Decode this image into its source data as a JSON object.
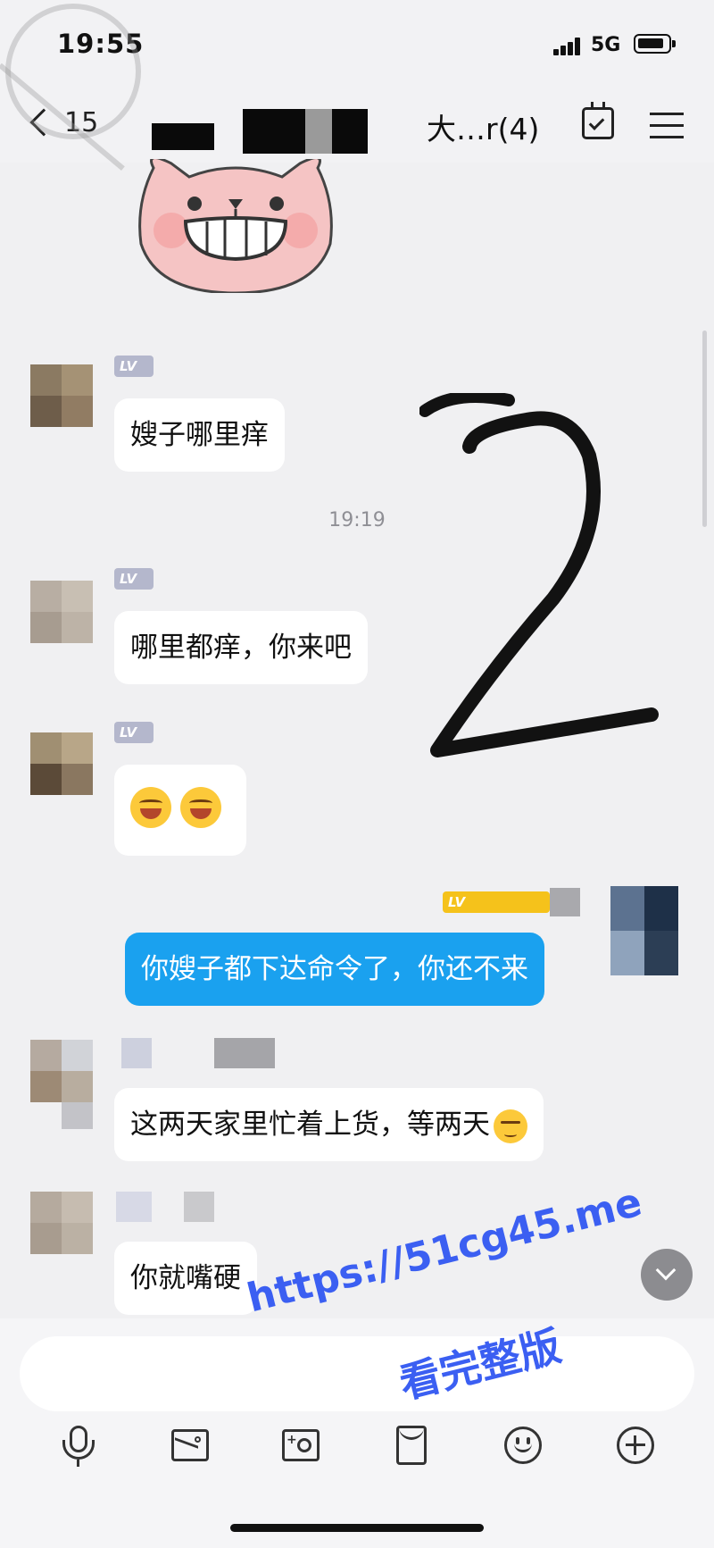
{
  "status_bar": {
    "time": "19:55",
    "network": "5G"
  },
  "header": {
    "back_count": "15",
    "title_visible_tail": "大…r(4)"
  },
  "messages": {
    "m1": {
      "text": "嫂子哪里痒"
    },
    "timestamp": "19:19",
    "m2": {
      "text": "哪里都痒，你来吧"
    },
    "m3": {
      "emoji": [
        "laugh-cry-emoji",
        "laugh-cry-emoji"
      ]
    },
    "m4": {
      "text": "你嫂子都下达命令了，你还不来",
      "self": true
    },
    "m5": {
      "text": "这两天家里忙着上货，等两天"
    },
    "m6": {
      "text": "你就嘴硬"
    }
  },
  "lv_badge": "LV",
  "watermark": {
    "url": "https://51cg45.me",
    "text": "看完整版"
  },
  "colors": {
    "bubble_self": "#1aa1ef",
    "bubble_other": "#ffffff",
    "background": "#f0f0f2",
    "watermark": "#3b5ff2"
  }
}
